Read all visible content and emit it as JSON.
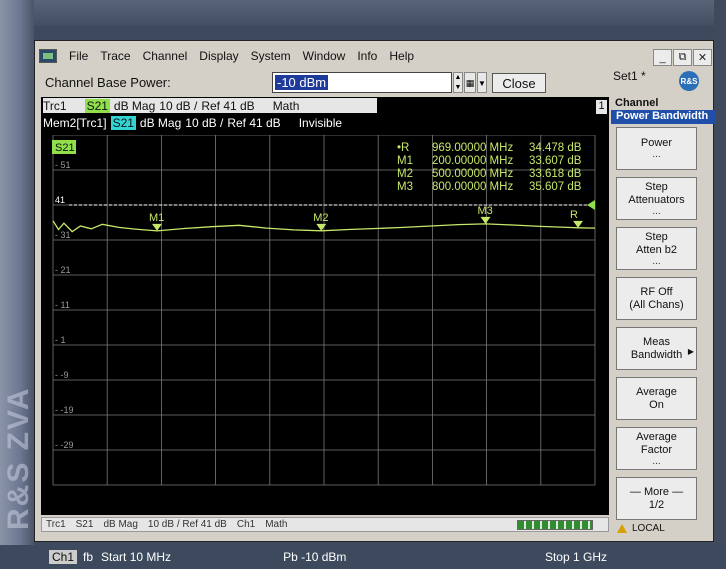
{
  "brand": {
    "text": "R&S ZVA",
    "small": "R&S"
  },
  "menu": [
    "File",
    "Trace",
    "Channel",
    "Display",
    "System",
    "Window",
    "Info",
    "Help"
  ],
  "window_controls": [
    "_",
    "⧉",
    "✕"
  ],
  "set_name": "Set1 *",
  "entry": {
    "label": "Channel Base Power:",
    "value": "-10 dBm",
    "close_label": "Close"
  },
  "traces": {
    "trc1": {
      "name": "Trc1",
      "param": "S21",
      "format": "dB Mag",
      "scale": "10 dB /",
      "ref": "Ref 41 dB",
      "mode": "Math"
    },
    "mem2": {
      "name": "Mem2[Trc1]",
      "param": "S21",
      "format": "dB Mag",
      "scale": "10 dB /",
      "ref": "Ref 41 dB",
      "mode": "Invisible"
    },
    "channel_number": "1"
  },
  "plot": {
    "active_label": "S21",
    "y_ticks": [
      "51",
      "41",
      "31",
      "21",
      "11",
      "1",
      "-9",
      "-19",
      "-29"
    ],
    "markers": [
      {
        "name": "•R",
        "freq": "969.00000 MHz",
        "value": "34.478 dB"
      },
      {
        "name": "M1",
        "freq": "200.00000 MHz",
        "value": "33.607 dB"
      },
      {
        "name": "M2",
        "freq": "500.00000 MHz",
        "value": "33.618 dB"
      },
      {
        "name": "M3",
        "freq": "800.00000 MHz",
        "value": "35.607 dB"
      }
    ],
    "marker_labels": [
      "M1",
      "M2",
      "M3",
      "R"
    ],
    "colors": {
      "trace": "#c6e86a",
      "grid": "#7a7a7a",
      "text": "#c6e86a",
      "ticks": "#9a9a9a"
    }
  },
  "chart_data": {
    "type": "line",
    "title": "",
    "xlabel": "",
    "ylabel": "",
    "xlim": [
      10,
      1000
    ],
    "ylim": [
      -39,
      61
    ],
    "x": [
      10,
      20,
      30,
      45,
      60,
      80,
      100,
      130,
      160,
      200,
      250,
      300,
      350,
      400,
      450,
      500,
      550,
      600,
      650,
      700,
      750,
      800,
      850,
      900,
      950,
      969,
      1000
    ],
    "series": [
      {
        "values": [
          36.5,
          34.0,
          35.8,
          33.4,
          35.0,
          34.2,
          35.5,
          34.6,
          34.1,
          33.607,
          34.3,
          34.8,
          35.2,
          34.4,
          33.9,
          33.618,
          34.0,
          34.3,
          34.6,
          35.0,
          35.4,
          35.607,
          35.3,
          34.9,
          34.6,
          34.478,
          34.4
        ]
      }
    ]
  },
  "footer": {
    "channel": "Ch1",
    "fb": "fb",
    "start": "Start  10 MHz",
    "power": "Pb  -10 dBm",
    "stop": "Stop  1 GHz"
  },
  "statusbar": [
    "Trc1",
    "S21",
    "dB Mag",
    "10 dB / Ref 41 dB",
    "Ch1",
    "Math"
  ],
  "local_label": "LOCAL",
  "softkeys": {
    "header": "Channel",
    "title": "Power Bandwidth",
    "buttons": [
      {
        "line1": "Power",
        "line2": "",
        "dots": "...",
        "arrow": ""
      },
      {
        "line1": "Step",
        "line2": "Attenuators",
        "dots": "...",
        "arrow": ""
      },
      {
        "line1": "Step",
        "line2": "Atten b2",
        "dots": "...",
        "arrow": ""
      },
      {
        "line1": "RF Off",
        "line2": "(All Chans)",
        "dots": "",
        "arrow": ""
      },
      {
        "line1": "Meas",
        "line2": "Bandwidth",
        "dots": "",
        "arrow": "▶"
      },
      {
        "line1": "Average",
        "line2": "On",
        "dots": "",
        "arrow": ""
      },
      {
        "line1": "Average",
        "line2": "Factor",
        "dots": "...",
        "arrow": ""
      },
      {
        "line1": "— More —",
        "line2": "1/2",
        "dots": "",
        "arrow": ""
      }
    ]
  }
}
